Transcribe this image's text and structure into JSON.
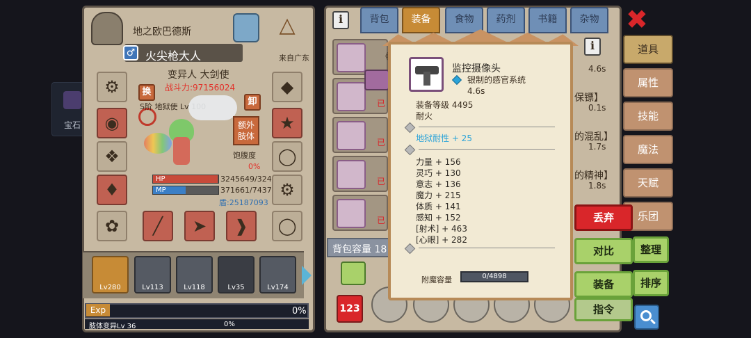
{
  "background_tile": {
    "label": "宝石"
  },
  "character": {
    "location": "地之欧巴德斯",
    "name": "火尖枪大人",
    "from": "来自广东",
    "class": "变异人 大剑使",
    "power_label": "战斗力:",
    "power": "97156024",
    "swap_button": "换",
    "unequip_button": "卸",
    "rank_text": "S阶 地狱使",
    "level_text": "Lv 100",
    "extra_limb_button": "额外肢体",
    "satiety_label": "饱腹度",
    "satiety_value": "0%",
    "hp_label": "HP",
    "hp_value": "3245649/324",
    "hp_fraction": 0.99,
    "mp_label": "MP",
    "mp_value": "371661/7437",
    "mp_fraction": 0.5,
    "shield": "盾:25187093"
  },
  "party": [
    {
      "level": "Lv280"
    },
    {
      "level": "Lv113"
    },
    {
      "level": "Lv118"
    },
    {
      "level": "Lv35"
    },
    {
      "level": "Lv174"
    }
  ],
  "exp": {
    "label": "Exp",
    "percent": "0%",
    "sub_label": "肢体变异Lv 36",
    "sub_percent": "0%"
  },
  "tabs": [
    "背包",
    "装备",
    "食物",
    "药剂",
    "书籍",
    "杂物"
  ],
  "active_tab": "装备",
  "inventory_rows": [
    {
      "name": "《",
      "value": "4.6s"
    },
    {
      "name": "已",
      "value": "保镖】",
      "sub": "0.1s"
    },
    {
      "name": "已",
      "value": "的混乱】",
      "sub": "1.7s"
    },
    {
      "name": "已",
      "value": "的精神】",
      "sub": "1.8s"
    },
    {
      "name": "已",
      "value": ""
    }
  ],
  "bag_capacity": "背包容量 18",
  "popup": {
    "item_name": "监控摄像头",
    "set_name": "银制的感官系统",
    "time": "4.6s",
    "equip_level": "装备等级 4495",
    "element": "耐火",
    "special": "地狱耐性 + 25",
    "stats": [
      "力量 + 156",
      "灵巧 + 130",
      "意志 + 136",
      "魔力 + 215",
      "体质 + 141",
      "感知 + 152",
      "[射术] + 463",
      "[心眼] + 282"
    ],
    "enchant_label": "附魔容量",
    "enchant_value": "0/4898"
  },
  "side_tabs": [
    "道具",
    "属性",
    "技能",
    "魔法",
    "天赋",
    "乐团"
  ],
  "actions": {
    "discard": "丢弃",
    "compare": "对比",
    "equip": "装备",
    "sort_tidy": "整理",
    "sort_order": "排序",
    "command": "指令"
  },
  "colors": {
    "power": "#e2312a",
    "special": "#2aa3d9",
    "discard": "#d9262a",
    "green": "#a9d16a"
  }
}
